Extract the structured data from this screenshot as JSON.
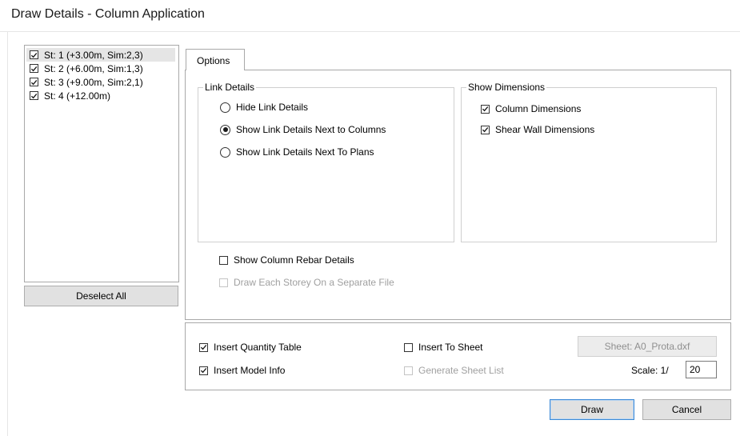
{
  "window": {
    "title": "Draw Details - Column Application"
  },
  "storeys": [
    {
      "label": "St: 1 (+3.00m, Sim:2,3)",
      "checked": true,
      "selected": true
    },
    {
      "label": "St: 2 (+6.00m, Sim:1,3)",
      "checked": true,
      "selected": false
    },
    {
      "label": "St: 3 (+9.00m, Sim:2,1)",
      "checked": true,
      "selected": false
    },
    {
      "label": "St: 4 (+12.00m)",
      "checked": true,
      "selected": false
    }
  ],
  "deselect_all_label": "Deselect All",
  "tabs": [
    {
      "label": "Options",
      "active": true
    }
  ],
  "link_details": {
    "group_label": "Link Details",
    "options": [
      {
        "label": "Hide Link Details",
        "selected": false
      },
      {
        "label": "Show Link Details Next to Columns",
        "selected": true
      },
      {
        "label": "Show Link Details Next To Plans",
        "selected": false
      }
    ]
  },
  "show_dimensions": {
    "group_label": "Show Dimensions",
    "column_dimensions": {
      "label": "Column Dimensions",
      "checked": true
    },
    "shear_wall_dimensions": {
      "label": "Shear Wall Dimensions",
      "checked": true
    }
  },
  "show_column_rebar_details": {
    "label": "Show Column Rebar Details",
    "checked": false
  },
  "draw_each_storey": {
    "label": "Draw Each Storey On a Separate File",
    "checked": false,
    "disabled": true
  },
  "insert_quantity_table": {
    "label": "Insert Quantity Table",
    "checked": true
  },
  "insert_model_info": {
    "label": "Insert Model Info",
    "checked": true
  },
  "insert_to_sheet": {
    "label": "Insert To Sheet",
    "checked": false
  },
  "generate_sheet_list": {
    "label": "Generate Sheet List",
    "checked": false,
    "disabled": true
  },
  "sheet_button_label": "Sheet: A0_Prota.dxf",
  "scale": {
    "label": "Scale: 1/",
    "value": "20"
  },
  "draw_button_label": "Draw",
  "cancel_button_label": "Cancel"
}
